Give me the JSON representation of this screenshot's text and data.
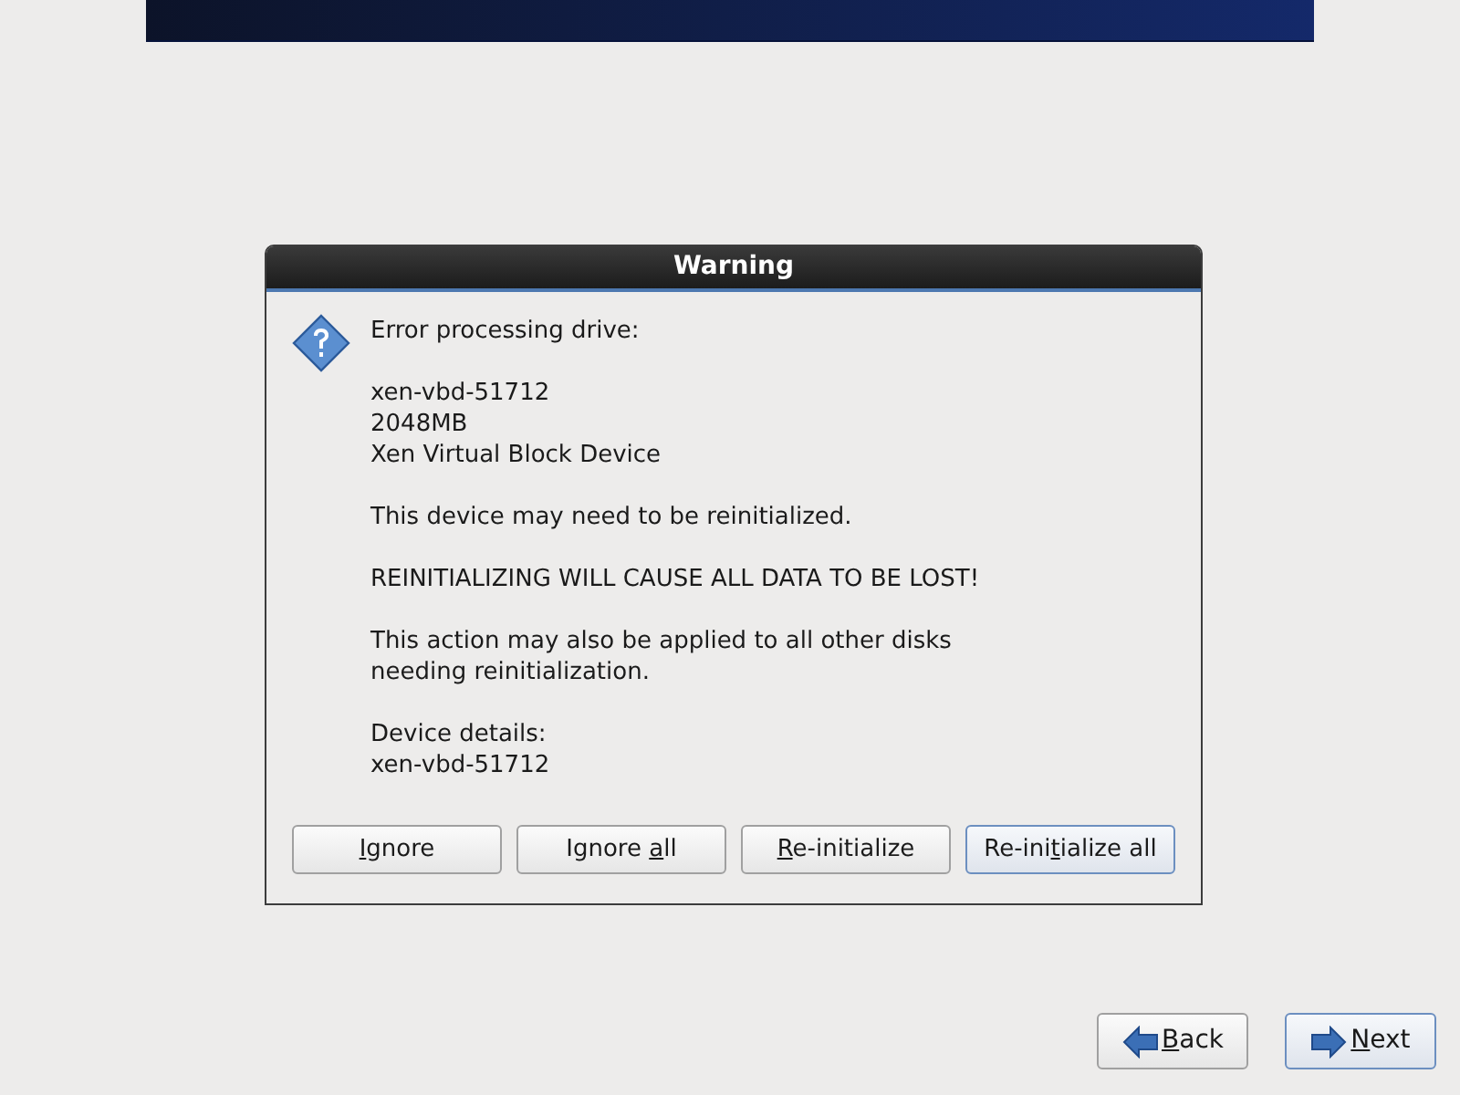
{
  "dialog": {
    "title": "Warning",
    "paragraphs": [
      [
        "Error processing drive:"
      ],
      [
        "xen-vbd-51712",
        "2048MB",
        "Xen Virtual Block Device"
      ],
      [
        "This device may need to be reinitialized."
      ],
      [
        "REINITIALIZING WILL CAUSE ALL DATA TO BE LOST!"
      ],
      [
        "This action may also be applied to all other disks",
        "needing reinitialization."
      ],
      [
        "Device details:",
        "xen-vbd-51712"
      ]
    ],
    "buttons": [
      {
        "key": "I",
        "post": "gnore",
        "focused": false
      },
      {
        "pre": "Ignore ",
        "key": "a",
        "post": "ll",
        "focused": false
      },
      {
        "key": "R",
        "post": "e-initialize",
        "focused": false
      },
      {
        "pre": "Re-ini",
        "key": "t",
        "post": "ialize all",
        "focused": true
      }
    ]
  },
  "nav_buttons": [
    {
      "kind": "back",
      "key": "B",
      "post": "ack",
      "focused": false
    },
    {
      "kind": "next",
      "key": "N",
      "post": "ext",
      "focused": true
    }
  ]
}
